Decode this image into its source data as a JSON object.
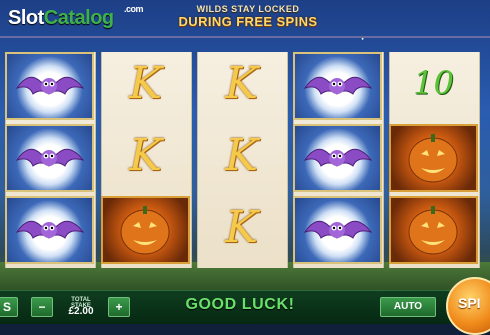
{
  "logo": {
    "part1": "Slot",
    "part2": "Catalog",
    "suffix": ".com"
  },
  "banner": {
    "line1": "WILDS STAY LOCKED",
    "line2": "DURING FREE SPINS"
  },
  "reels": [
    [
      "bat",
      "bat",
      "bat"
    ],
    [
      "K",
      "K",
      ""
    ],
    [
      "K",
      "K",
      "K"
    ],
    [
      "bat",
      "bat",
      "bat"
    ],
    [
      "10",
      "pumpkin",
      "pumpkin"
    ]
  ],
  "reel1_row3": "pumpkin",
  "symbols": {
    "k": "K",
    "ten": "10"
  },
  "controls": {
    "left_button_partial": "S",
    "minus": "−",
    "stake_label": "TOTAL STAKE",
    "stake_value": "£2.00",
    "plus": "+",
    "message": "GOOD LUCK!",
    "auto": "AUTO",
    "spin": "SPI"
  },
  "colors": {
    "accent": "#3fb14a",
    "bar": "#062812",
    "spin": "#f08a1a"
  }
}
